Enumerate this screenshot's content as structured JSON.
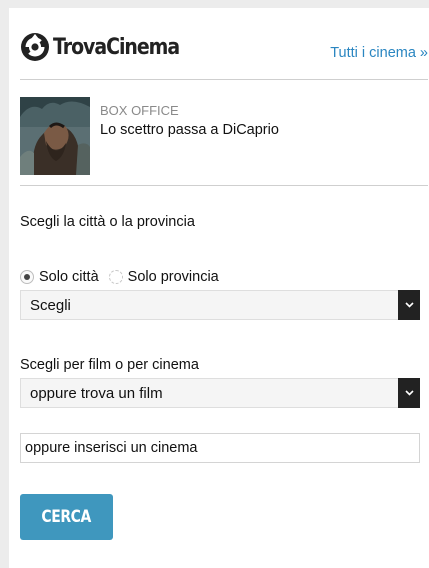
{
  "brand": {
    "name": "TrovaCinema",
    "logo_icon": "film-reel-icon",
    "all_cinemas_link": "Tutti i cinema »"
  },
  "news": {
    "kicker": "BOX OFFICE",
    "title": "Lo scettro passa a DiCaprio",
    "thumbnail": "movie-still-photo"
  },
  "location": {
    "label": "Scegli la città o la provincia",
    "options": [
      {
        "label": "Solo città",
        "checked": true
      },
      {
        "label": "Solo provincia",
        "checked": false
      }
    ],
    "select_value": "Scegli"
  },
  "search": {
    "label": "Scegli per film o per cinema",
    "film_select_value": "oppure trova un film",
    "cinema_placeholder": "oppure inserisci un cinema",
    "submit_label": "CERCA"
  },
  "colors": {
    "accent": "#3f97be",
    "link": "#2a86c1",
    "select_arrow_bg": "#222222"
  }
}
